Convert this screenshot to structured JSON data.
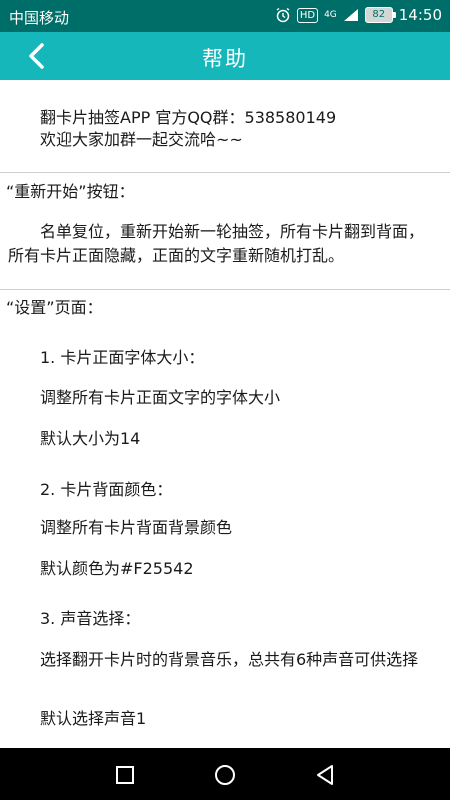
{
  "status": {
    "carrier": "中国移动",
    "hd": "HD",
    "signal": "4G",
    "battery": "82",
    "time": "14:50"
  },
  "app_bar": {
    "title": "帮助"
  },
  "intro": {
    "line1": "翻卡片抽签APP 官方QQ群：538580149",
    "line2": "欢迎大家加群一起交流哈~~"
  },
  "restart": {
    "heading": "“重新开始”按钮：",
    "description": "名单复位，重新开始新一轮抽签，所有卡片翻到背面，所有卡片正面隐藏，正面的文字重新随机打乱。"
  },
  "settings": {
    "heading": "“设置”页面：",
    "items": [
      {
        "title": "1. 卡片正面字体大小：",
        "desc": "调整所有卡片正面文字的字体大小",
        "default": "默认大小为14"
      },
      {
        "title": "2. 卡片背面颜色：",
        "desc": "调整所有卡片背面背景颜色",
        "default": "默认颜色为#F25542"
      },
      {
        "title": "3. 声音选择：",
        "desc": "选择翻开卡片时的背景音乐，总共有6种声音可供选择",
        "default": "默认选择声音1"
      }
    ]
  },
  "colors": {
    "status_bar": "#006e68",
    "app_bar": "#16b7bb",
    "nav_bar": "#000000"
  }
}
